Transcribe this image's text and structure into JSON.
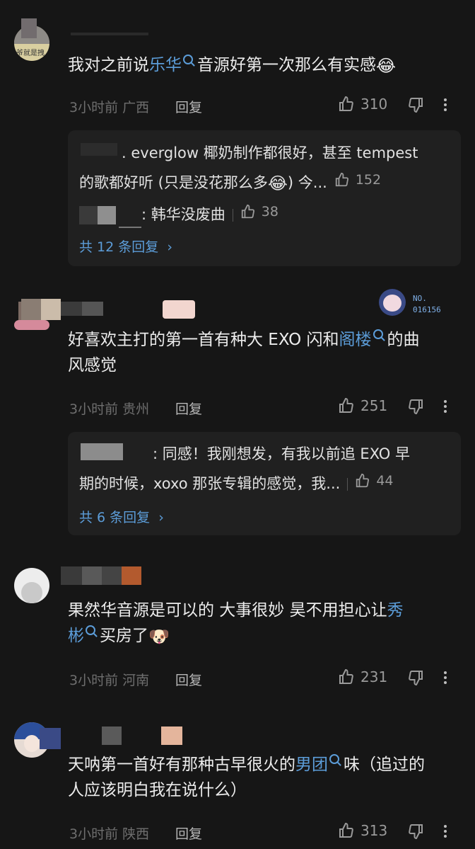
{
  "comments": [
    {
      "text_before": "我对之前说",
      "link": "乐华",
      "text_after": "音源好第一次那么有实感",
      "emoji": "😂",
      "avatar_text": "爷就是拽",
      "time": "3小时前",
      "region": "广西",
      "reply_label": "回复",
      "likes": "310",
      "replies": [
        {
          "name": "",
          "text_top": ". everglow 椰奶制作都很好，甚至 tempest",
          "text_bottom": "的歌都好听 (只是没花那么多",
          "emoji": "😂",
          "suffix": ") 今...",
          "likes": "152"
        },
        {
          "name": "",
          "text": ": 韩华没废曲",
          "likes": "38"
        }
      ],
      "more_replies": "共 12 条回复"
    },
    {
      "text_line1": "好喜欢主打的第一首有种大 EXO 闪和",
      "link": "阁楼",
      "text_after": "的曲",
      "text_line2": "风感觉",
      "badge_no": "NO.",
      "badge_num": "016156",
      "time": "3小时前",
      "region": "贵州",
      "reply_label": "回复",
      "likes": "251",
      "reply_text_top": ": 同感！我刚想发，有我以前追 EXO 早",
      "reply_text_bottom": "期的时候，xoxo 那张专辑的感觉，我...",
      "reply_likes": "44",
      "more_replies": "共 6 条回复"
    },
    {
      "text_line1": "果然华音源是可以的 大事很妙 昊不用担心让",
      "link_a": "秀",
      "link_b": "彬",
      "text_after": "买房了",
      "emoji": "🐶",
      "time": "3小时前",
      "region": "河南",
      "reply_label": "回复",
      "likes": "231"
    },
    {
      "text_line1": "天呐第一首好有那种古早很火的",
      "link": "男团",
      "text_after": "味（追过的",
      "text_line2": "人应该明白我在说什么）",
      "time": "3小时前",
      "region": "陕西",
      "reply_label": "回复",
      "likes": "313"
    }
  ]
}
